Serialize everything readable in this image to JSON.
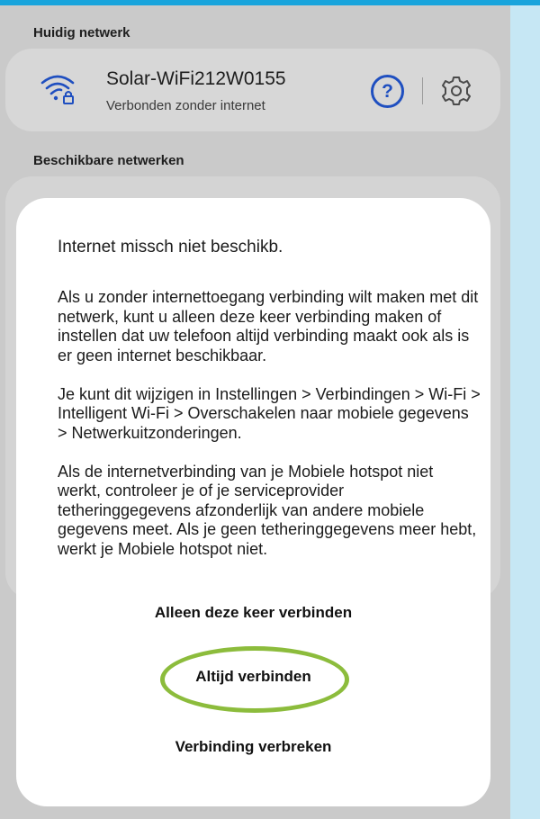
{
  "current_network": {
    "section_label": "Huidig netwerk",
    "name": "Solar-WiFi212W0155",
    "status": "Verbonden zonder internet",
    "help_glyph": "?",
    "icons": [
      "wifi-lock-icon",
      "help-icon",
      "gear-icon"
    ],
    "accent_color": "#1f4fc0"
  },
  "available_networks": {
    "section_label": "Beschikbare netwerken"
  },
  "dialog": {
    "title": "Internet missch niet beschikb.",
    "paragraphs": [
      "Als u zonder internettoegang verbinding wilt maken met dit netwerk, kunt u alleen deze keer verbinding maken of instellen dat uw telefoon altijd verbinding maakt ook als is er geen internet beschikbaar.",
      "Je kunt dit wijzigen in Instellingen > Verbindingen > Wi-Fi > Intelligent Wi-Fi > Overschakelen naar mobiele gegevens > Netwerkuitzonderingen.",
      "Als de internetverbinding van je Mobiele hotspot niet werkt, controleer je of je serviceprovider tetheringgegevens afzonderlijk van andere mobiele gegevens meet. Als je geen tetheringgegevens meer hebt, werkt je Mobiele hotspot niet."
    ],
    "actions": {
      "connect_once": "Alleen deze keer verbinden",
      "always_connect": "Altijd verbinden",
      "disconnect": "Verbinding verbreken"
    },
    "highlight_color": "#8cbc3c"
  }
}
